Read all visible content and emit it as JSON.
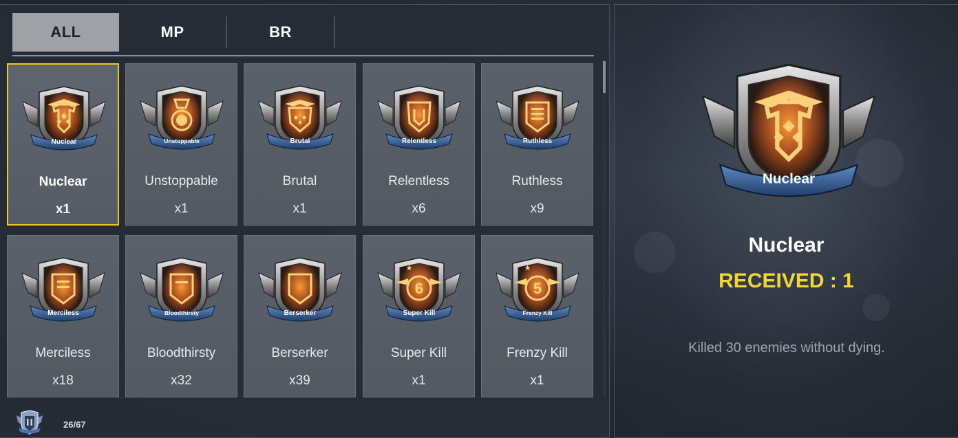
{
  "tabs": [
    {
      "label": "ALL",
      "active": true
    },
    {
      "label": "MP",
      "active": false
    },
    {
      "label": "BR",
      "active": false
    }
  ],
  "medals": [
    {
      "name": "Nuclear",
      "banner": "Nuclear",
      "count": "x1",
      "glyph": "nuclear",
      "selected": true
    },
    {
      "name": "Unstoppable",
      "banner": "Unstoppable",
      "count": "x1",
      "glyph": "medal"
    },
    {
      "name": "Brutal",
      "banner": "Brutal",
      "count": "x1",
      "glyph": "brutal"
    },
    {
      "name": "Relentless",
      "banner": "Relentless",
      "count": "x6",
      "glyph": "relentless"
    },
    {
      "name": "Ruthless",
      "banner": "Ruthless",
      "count": "x9",
      "glyph": "lines"
    },
    {
      "name": "Merciless",
      "banner": "Merciless",
      "count": "x18",
      "glyph": "lines2"
    },
    {
      "name": "Bloodthirsty",
      "banner": "Bloodthirsty",
      "count": "x32",
      "glyph": "shield1"
    },
    {
      "name": "Berserker",
      "banner": "Berserker",
      "count": "x39",
      "glyph": "shield0"
    },
    {
      "name": "Super Kill",
      "banner": "Super Kill",
      "count": "x1",
      "glyph": "num",
      "num": "6"
    },
    {
      "name": "Frenzy Kill",
      "banner": "Frenzy Kill",
      "count": "x1",
      "glyph": "num",
      "num": "5"
    }
  ],
  "footer": {
    "progress": "26/67",
    "icon": "medal-collection-icon"
  },
  "detail": {
    "banner": "Nuclear",
    "name": "Nuclear",
    "received": "RECEIVED : 1",
    "description": "Killed 30 enemies without dying."
  },
  "colors": {
    "selected_border": "#f2c51c",
    "received_text": "#f4d735",
    "emblem_glow": "#ff8a1a"
  }
}
